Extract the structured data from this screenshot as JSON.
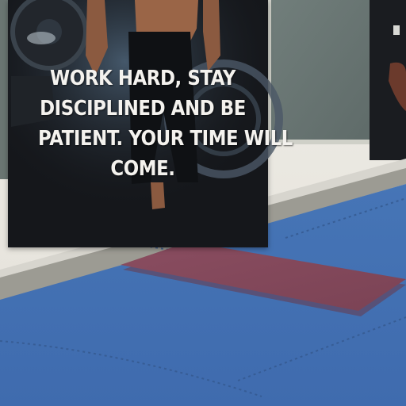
{
  "poster": {
    "caption_lines": [
      "WORK HARD, STAY",
      "DISCIPLINED AND BE",
      "PATIENT. YOUR TIME WILL",
      "COME."
    ]
  },
  "colors": {
    "wall": "#e6e3dc",
    "poster_background": "#15171b",
    "board": "#6a7775",
    "floor_mat": "#3f6fb2",
    "yoga_mat": "#83495a",
    "baseboard": "#9b9a92"
  }
}
